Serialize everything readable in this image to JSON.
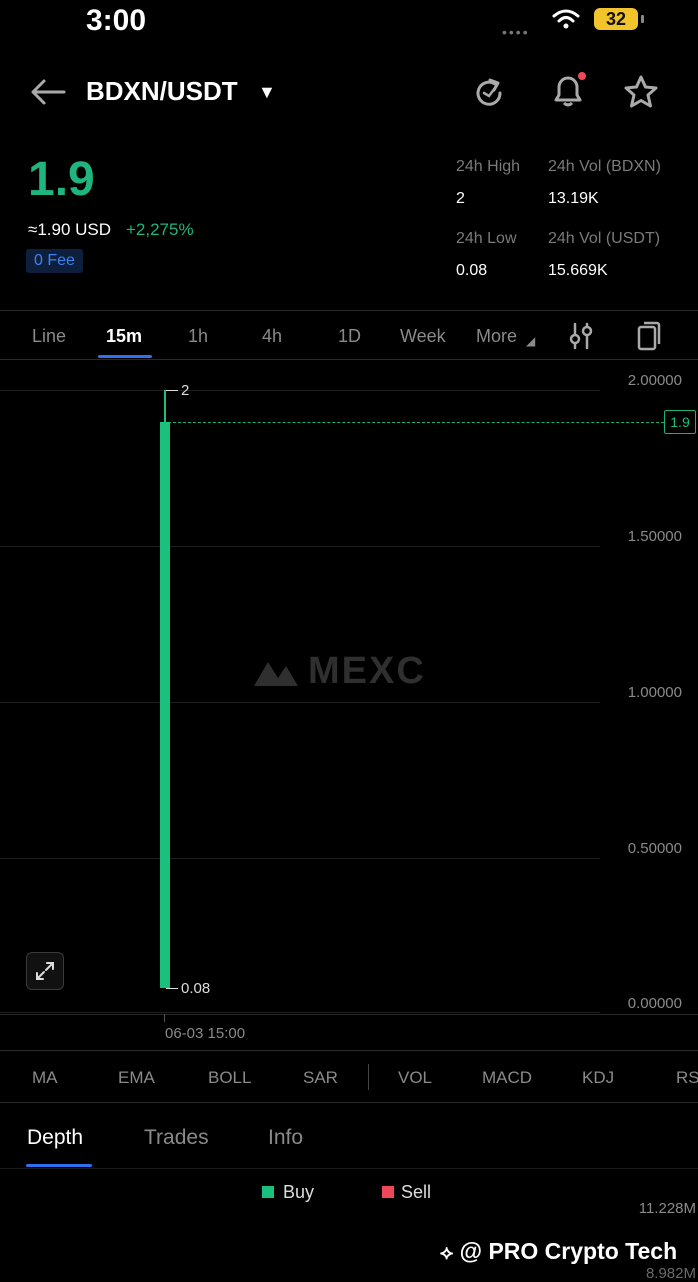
{
  "status_bar": {
    "time": "3:00",
    "signal_dots": "••••",
    "battery": "32"
  },
  "header": {
    "pair": "BDXN/USDT"
  },
  "price": {
    "last": "1.9",
    "approx": "≈1.90  USD",
    "change": "+2,275%",
    "fee_badge": "0 Fee"
  },
  "stats": {
    "high_label": "24h High",
    "high_value": "2",
    "vol_base_label": "24h Vol (BDXN)",
    "vol_base_value": "13.19K",
    "low_label": "24h Low",
    "low_value": "0.08",
    "vol_quote_label": "24h Vol  (USDT)",
    "vol_quote_value": "15.669K"
  },
  "timeframes": [
    "Line",
    "15m",
    "1h",
    "4h",
    "1D",
    "Week",
    "More"
  ],
  "chart": {
    "y_ticks": [
      "2.00000",
      "1.50000",
      "1.00000",
      "0.50000",
      "0.00000"
    ],
    "current_price_tag": "1.9",
    "high_marker": "2",
    "low_marker": "0.08",
    "time_label": "06-03 15:00",
    "watermark": "MEXC"
  },
  "chart_data": {
    "type": "candlestick",
    "x": [
      "06-03 15:00"
    ],
    "open": [
      0.08
    ],
    "close": [
      1.9
    ],
    "high": [
      2
    ],
    "low": [
      0.08
    ],
    "ylim": [
      0,
      2
    ],
    "current_price": 1.9
  },
  "indicators": [
    "MA",
    "EMA",
    "BOLL",
    "SAR",
    "VOL",
    "MACD",
    "KDJ",
    "RS"
  ],
  "bottom_tabs": [
    "Depth",
    "Trades",
    "Info"
  ],
  "depth": {
    "buy_label": "Buy",
    "sell_label": "Sell",
    "vol_top": "11.228M",
    "vol_bottom": "8.982M",
    "buy_color": "#19c07e",
    "sell_color": "#f0475a"
  },
  "overlay": {
    "credit": "@ PRO Crypto Tech"
  }
}
